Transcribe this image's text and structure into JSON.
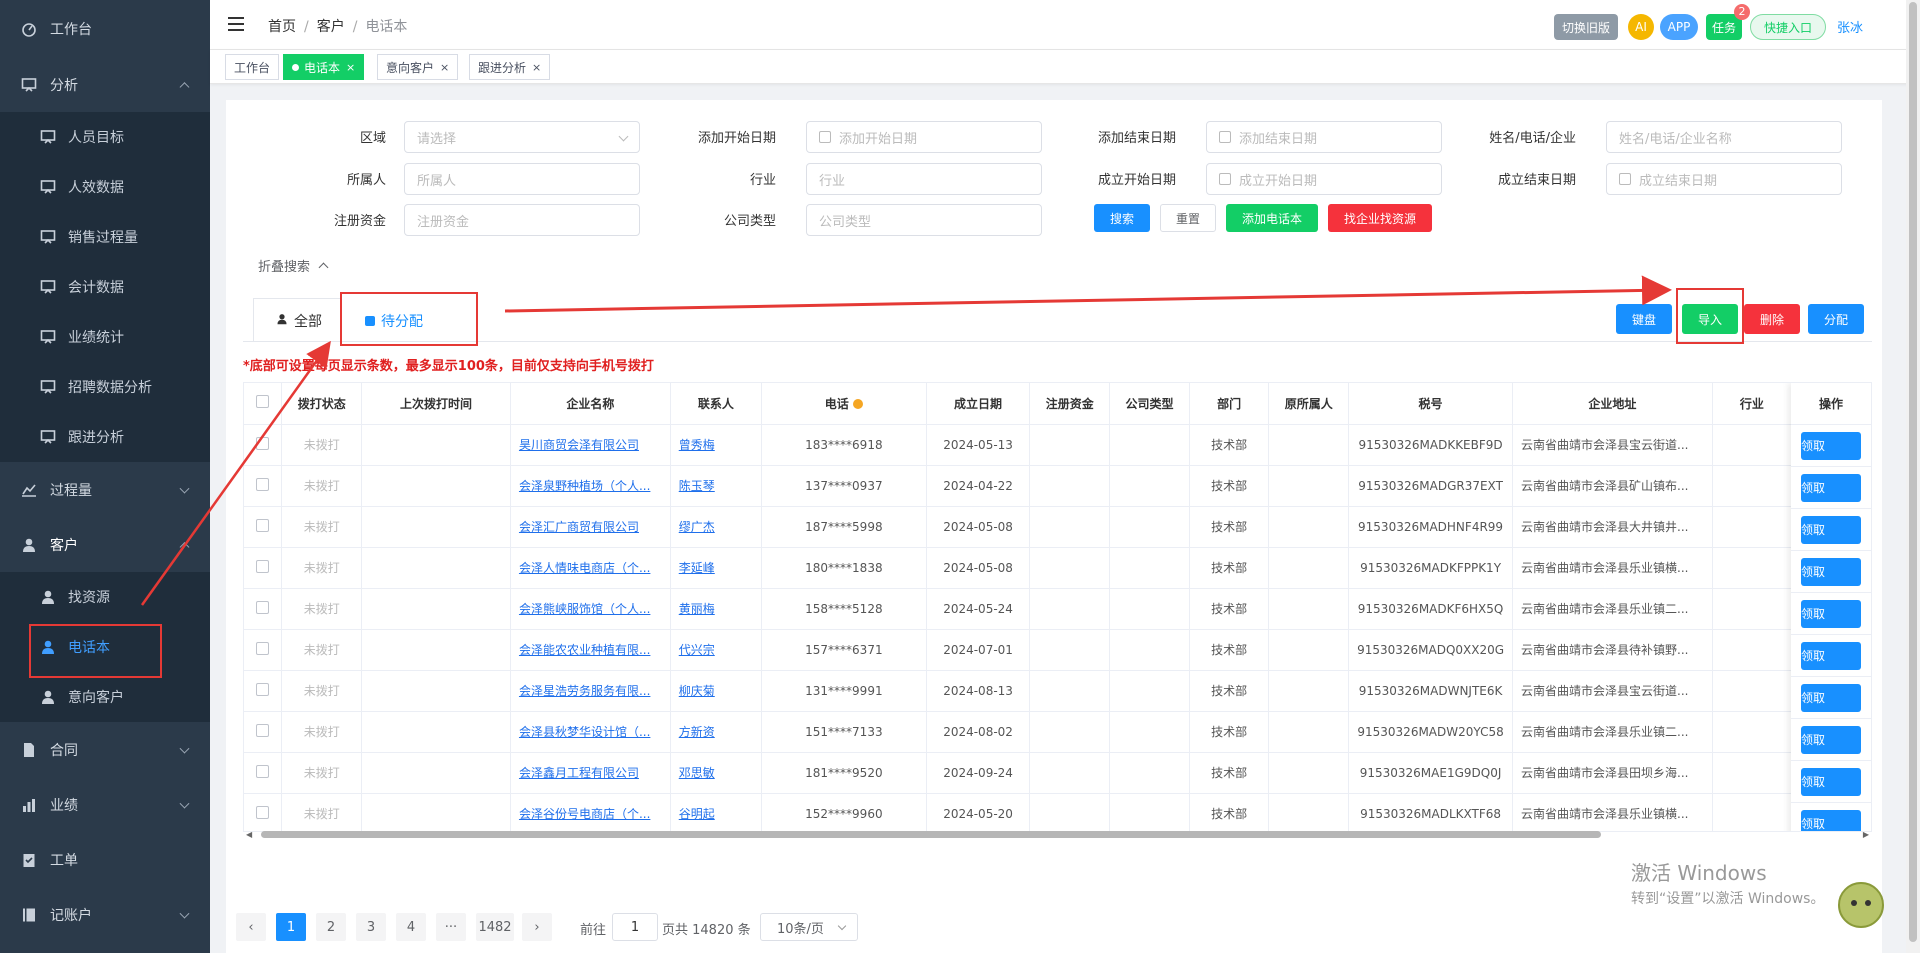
{
  "sidebar": {
    "items": [
      {
        "label": "工作台",
        "icon": "dashboard-icon"
      },
      {
        "label": "分析",
        "icon": "chart-icon"
      },
      {
        "label": "人员目标",
        "icon": "chart-icon"
      },
      {
        "label": "人效数据",
        "icon": "chart-icon"
      },
      {
        "label": "销售过程量",
        "icon": "chart-icon"
      },
      {
        "label": "会计数据",
        "icon": "chart-icon"
      },
      {
        "label": "业绩统计",
        "icon": "chart-icon"
      },
      {
        "label": "招聘数据分析",
        "icon": "chart-icon"
      },
      {
        "label": "跟进分析",
        "icon": "chart-icon"
      },
      {
        "label": "过程量",
        "icon": "trend-icon"
      },
      {
        "label": "客户",
        "icon": "user-icon"
      },
      {
        "label": "找资源",
        "icon": "user-icon"
      },
      {
        "label": "电话本",
        "icon": "user-icon"
      },
      {
        "label": "意向客户",
        "icon": "user-icon"
      },
      {
        "label": "合同",
        "icon": "document-icon"
      },
      {
        "label": "业绩",
        "icon": "achievement-icon"
      },
      {
        "label": "工单",
        "icon": "clipboard-icon"
      },
      {
        "label": "记账户",
        "icon": "book-icon"
      }
    ]
  },
  "header": {
    "breadcrumb": [
      "首页",
      "客户",
      "电话本"
    ],
    "switch_old": "切换旧版",
    "ai": "AI",
    "app": "APP",
    "task": "任务",
    "task_count": "2",
    "quick_entry": "快捷入口",
    "user": "张冰"
  },
  "tags": [
    {
      "label": "工作台"
    },
    {
      "label": "电话本"
    },
    {
      "label": "意向客户"
    },
    {
      "label": "跟进分析"
    }
  ],
  "filters": {
    "region_label": "区域",
    "region_placeholder": "请选择",
    "add_start_label": "添加开始日期",
    "add_start_placeholder": "添加开始日期",
    "add_end_label": "添加结束日期",
    "add_end_placeholder": "添加结束日期",
    "name_label": "姓名/电话/企业",
    "name_placeholder": "姓名/电话/企业名称",
    "owner_label": "所属人",
    "owner_placeholder": "所属人",
    "industry_label": "行业",
    "industry_placeholder": "行业",
    "found_start_label": "成立开始日期",
    "found_start_placeholder": "成立开始日期",
    "found_end_label": "成立结束日期",
    "found_end_placeholder": "成立结束日期",
    "capital_label": "注册资金",
    "capital_placeholder": "注册资金",
    "type_label": "公司类型",
    "type_placeholder": "公司类型",
    "search_btn": "搜索",
    "reset_btn": "重置",
    "add_phone_btn": "添加电话本",
    "find_btn": "找企业找资源",
    "collapse": "折叠搜索"
  },
  "tabs": {
    "all": "全部",
    "pending": "待分配"
  },
  "actions": {
    "keypad": "键盘",
    "import": "导入",
    "delete": "删除",
    "assign": "分配"
  },
  "notice": "*底部可设置每页显示条数，最多显示100条，目前仅支持向手机号拨打",
  "table": {
    "headers": [
      "拨打状态",
      "上次拨打时间",
      "企业名称",
      "联系人",
      "电话",
      "成立日期",
      "注册资金",
      "公司类型",
      "部门",
      "原所属人",
      "税号",
      "企业地址",
      "行业",
      "操作"
    ],
    "action_label": "领取",
    "rows": [
      {
        "status": "未拨打",
        "last": "",
        "company": "昊川商贸会泽有限公司",
        "contact": "曾秀梅",
        "phone": "183****6918",
        "date": "2024-05-13",
        "capital": "",
        "type": "",
        "dept": "技术部",
        "orig": "",
        "tax": "91530326MADKKEBF9D",
        "addr": "云南省曲靖市会泽县宝云街道...",
        "industry": ""
      },
      {
        "status": "未拨打",
        "last": "",
        "company": "会泽泉野种植场（个人...",
        "contact": "陈玉琴",
        "phone": "137****0937",
        "date": "2024-04-22",
        "capital": "",
        "type": "",
        "dept": "技术部",
        "orig": "",
        "tax": "91530326MADGR37EXT",
        "addr": "云南省曲靖市会泽县矿山镇布...",
        "industry": ""
      },
      {
        "status": "未拨打",
        "last": "",
        "company": "会泽汇广商贸有限公司",
        "contact": "缪广杰",
        "phone": "187****5998",
        "date": "2024-05-08",
        "capital": "",
        "type": "",
        "dept": "技术部",
        "orig": "",
        "tax": "91530326MADHNF4R99",
        "addr": "云南省曲靖市会泽县大井镇井...",
        "industry": ""
      },
      {
        "status": "未拨打",
        "last": "",
        "company": "会泽人情味电商店（个...",
        "contact": "李延峰",
        "phone": "180****1838",
        "date": "2024-05-08",
        "capital": "",
        "type": "",
        "dept": "技术部",
        "orig": "",
        "tax": "91530326MADKFPPK1Y",
        "addr": "云南省曲靖市会泽县乐业镇横...",
        "industry": ""
      },
      {
        "status": "未拨打",
        "last": "",
        "company": "会泽熊峡服饰馆（个人...",
        "contact": "黄丽梅",
        "phone": "158****5128",
        "date": "2024-05-24",
        "capital": "",
        "type": "",
        "dept": "技术部",
        "orig": "",
        "tax": "91530326MADKF6HX5Q",
        "addr": "云南省曲靖市会泽县乐业镇二...",
        "industry": ""
      },
      {
        "status": "未拨打",
        "last": "",
        "company": "会泽能农农业种植有限...",
        "contact": "代兴宗",
        "phone": "157****6371",
        "date": "2024-07-01",
        "capital": "",
        "type": "",
        "dept": "技术部",
        "orig": "",
        "tax": "91530326MADQ0XX20G",
        "addr": "云南省曲靖市会泽县待补镇野...",
        "industry": ""
      },
      {
        "status": "未拨打",
        "last": "",
        "company": "会泽星浩劳务服务有限...",
        "contact": "柳庆菊",
        "phone": "131****9991",
        "date": "2024-08-13",
        "capital": "",
        "type": "",
        "dept": "技术部",
        "orig": "",
        "tax": "91530326MADWNJTE6K",
        "addr": "云南省曲靖市会泽县宝云街道...",
        "industry": ""
      },
      {
        "status": "未拨打",
        "last": "",
        "company": "会泽县秋梦华设计馆（...",
        "contact": "方新资",
        "phone": "151****7133",
        "date": "2024-08-02",
        "capital": "",
        "type": "",
        "dept": "技术部",
        "orig": "",
        "tax": "91530326MADW20YC58",
        "addr": "云南省曲靖市会泽县乐业镇二...",
        "industry": ""
      },
      {
        "status": "未拨打",
        "last": "",
        "company": "会泽鑫月工程有限公司",
        "contact": "邓思敏",
        "phone": "181****9520",
        "date": "2024-09-24",
        "capital": "",
        "type": "",
        "dept": "技术部",
        "orig": "",
        "tax": "91530326MAE1G9DQ0J",
        "addr": "云南省曲靖市会泽县田坝乡海...",
        "industry": ""
      },
      {
        "status": "未拨打",
        "last": "",
        "company": "会泽谷份号电商店（个...",
        "contact": "谷明起",
        "phone": "152****9960",
        "date": "2024-05-20",
        "capital": "",
        "type": "",
        "dept": "技术部",
        "orig": "",
        "tax": "91530326MADLKXTF68",
        "addr": "云南省曲靖市会泽县乐业镇横...",
        "industry": ""
      }
    ]
  },
  "pagination": {
    "pages": [
      "1",
      "2",
      "3",
      "4",
      "···",
      "1482"
    ],
    "goto": "前往",
    "goto_value": "1",
    "total": "页共 14820 条",
    "size": "10条/页"
  },
  "windows_watermark": {
    "line1": "激活 Windows",
    "line2": "转到“设置”以激活 Windows。"
  },
  "colors": {
    "primary": "#1890ff",
    "success": "#13ce66",
    "danger": "#f5323c",
    "sidebar": "#2b3a4a",
    "annotation": "#e53935"
  }
}
